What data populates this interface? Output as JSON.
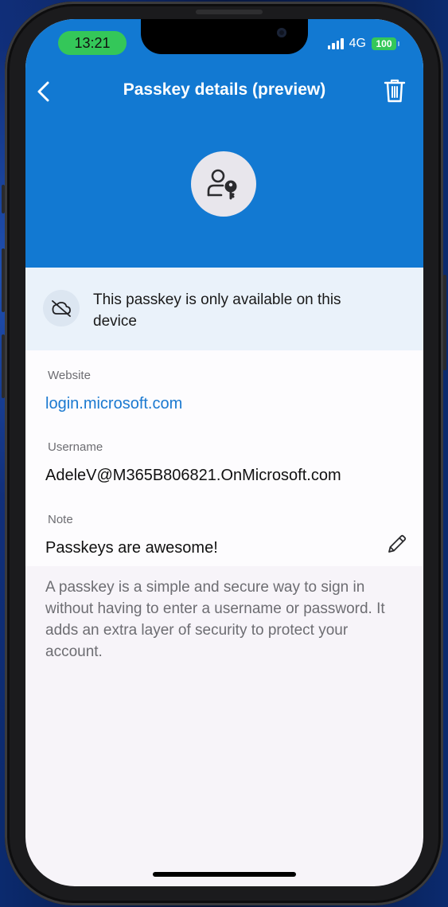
{
  "status_bar": {
    "time": "13:21",
    "network": "4G",
    "battery": "100"
  },
  "header": {
    "title": "Passkey details (preview)",
    "back_icon": "chevron-left-icon",
    "delete_icon": "trash-icon",
    "avatar_icon": "person-key-icon",
    "background_color": "#1279d2"
  },
  "banner": {
    "icon": "cloud-off-icon",
    "text": "This passkey is only available on this device"
  },
  "details": {
    "website_label": "Website",
    "website_value": "login.microsoft.com",
    "username_label": "Username",
    "username_value": "AdeleV@M365B806821.OnMicrosoft.com",
    "note_label": "Note",
    "note_value": "Passkeys are awesome!",
    "edit_icon": "pencil-icon"
  },
  "description": "A passkey is a simple and secure way to sign in without having to enter a username or password. It adds an extra layer of security to protect your account."
}
